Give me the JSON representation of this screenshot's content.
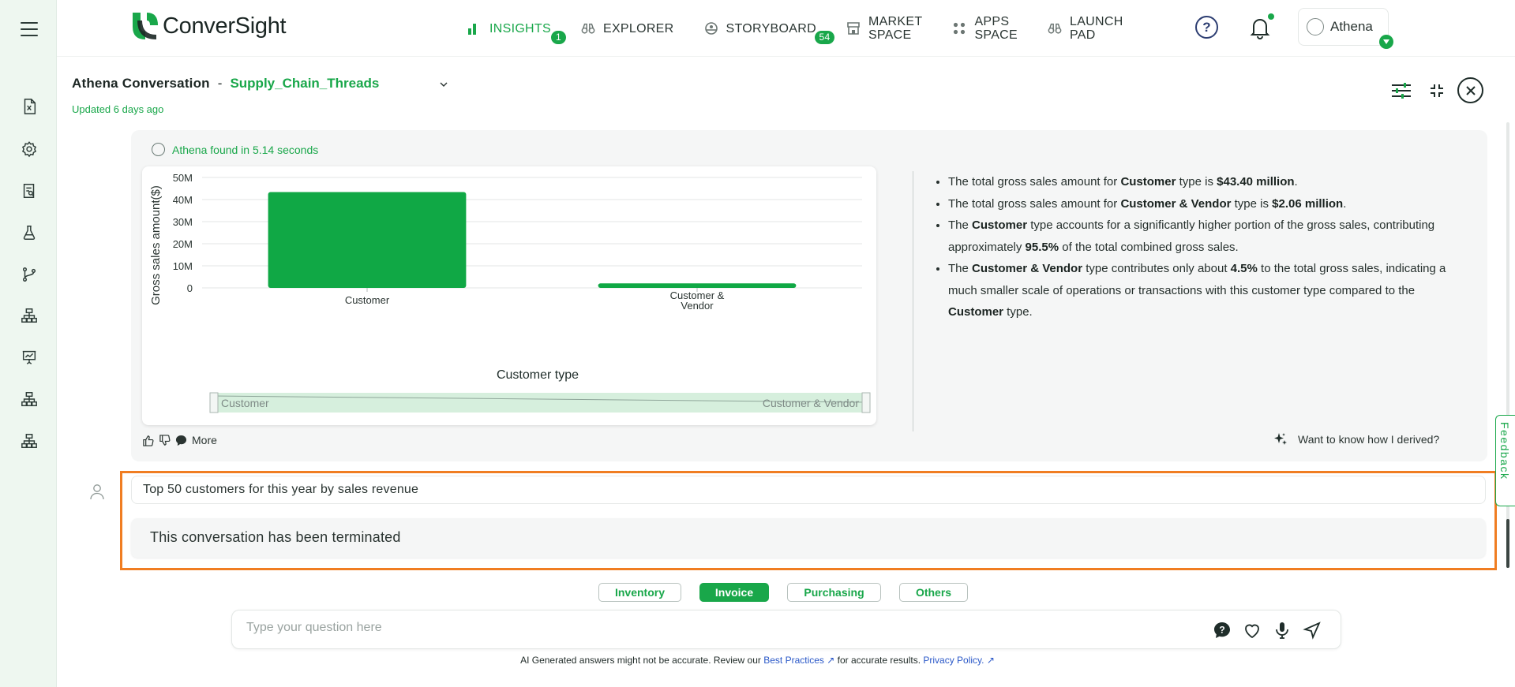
{
  "app": {
    "name": "ConverSight"
  },
  "nav": {
    "items": [
      {
        "label": "INSIGHTS",
        "badge": "1",
        "icon": "bar-chart-icon"
      },
      {
        "label": "EXPLORER",
        "icon": "binoculars-icon"
      },
      {
        "label": "STORYBOARD",
        "badge": "54",
        "icon": "storyboard-icon"
      },
      {
        "label": "MARKET\nSPACE",
        "line1": "MARKET",
        "line2": "SPACE",
        "icon": "market-icon"
      },
      {
        "label": "APPS\nSPACE",
        "line1": "APPS",
        "line2": "SPACE",
        "icon": "apps-grid-icon"
      },
      {
        "label": "LAUNCH\nPAD",
        "line1": "LAUNCH",
        "line2": "PAD",
        "icon": "launch-binoculars-icon"
      }
    ]
  },
  "user": {
    "name": "Athena"
  },
  "conversation": {
    "title": "Athena Conversation",
    "separator": "-",
    "name": "Supply_Chain_Threads",
    "updated": "Updated 6 days ago"
  },
  "answer": {
    "found_text": "Athena found in 5.14 seconds",
    "feedback_more": "More",
    "derive_text": "Want to know how I derived?",
    "insights": [
      {
        "parts": [
          "The total gross sales amount for ",
          "Customer",
          " type is ",
          "$43.40 million",
          "."
        ]
      },
      {
        "parts": [
          "The total gross sales amount for ",
          "Customer & Vendor",
          " type is ",
          "$2.06 million",
          "."
        ]
      },
      {
        "parts": [
          "The ",
          "Customer",
          " type accounts for a significantly higher portion of the gross sales, contributing approximately ",
          "95.5%",
          " of the total combined gross sales."
        ]
      },
      {
        "parts": [
          "The ",
          "Customer & Vendor",
          " type contributes only about ",
          "4.5%",
          " to the total gross sales, indicating a much smaller scale of operations or transactions with this customer type compared to the ",
          "Customer",
          " type."
        ]
      }
    ]
  },
  "chart_data": {
    "type": "bar",
    "categories": [
      "Customer",
      "Customer & Vendor"
    ],
    "values": [
      43.4,
      2.06
    ],
    "unit_scale": "million",
    "xlabel": "Customer type",
    "ylabel": "Gross sales amount($)",
    "yticks": [
      "0",
      "10M",
      "20M",
      "30M",
      "40M",
      "50M"
    ],
    "ylim": [
      0,
      50
    ],
    "bar_color": "#10a845",
    "grid": true,
    "slider": {
      "start_label": "Customer",
      "end_label": "Customer & Vendor"
    }
  },
  "question": {
    "text": "Top 50 customers for this year by sales revenue"
  },
  "terminated": {
    "text": "This conversation has been terminated"
  },
  "chips": [
    {
      "label": "Inventory",
      "active": false
    },
    {
      "label": "Invoice",
      "active": true
    },
    {
      "label": "Purchasing",
      "active": false
    },
    {
      "label": "Others",
      "active": false
    }
  ],
  "ask": {
    "placeholder": "Type your question here"
  },
  "disclaimer": {
    "before": "AI Generated answers might not be accurate. Review our ",
    "link1": "Best Practices",
    "middle": " for accurate results. ",
    "link2": "Privacy Policy."
  },
  "feedback_tab": "Feedback",
  "colors": {
    "accent": "#19a74a",
    "highlight": "#f07d22"
  }
}
